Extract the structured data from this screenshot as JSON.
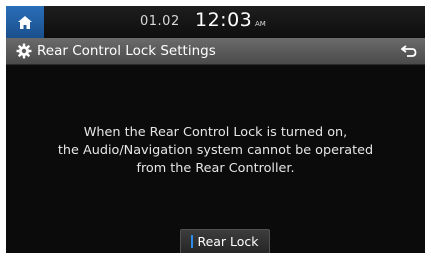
{
  "status_bar": {
    "date": "01.02",
    "time": "12:03",
    "ampm": "AM"
  },
  "header": {
    "title": "Rear Control Lock Settings"
  },
  "icons": {
    "home": "home-icon",
    "settings": "gear-icon",
    "back": "back-arrow-icon"
  },
  "main": {
    "message_lines": [
      "When the Rear Control Lock is turned on,",
      "the Audio/Navigation system cannot be operated",
      "from the Rear Controller."
    ],
    "rear_lock_label": "Rear Lock",
    "rear_lock_indicator_color": "#2e8be8"
  }
}
